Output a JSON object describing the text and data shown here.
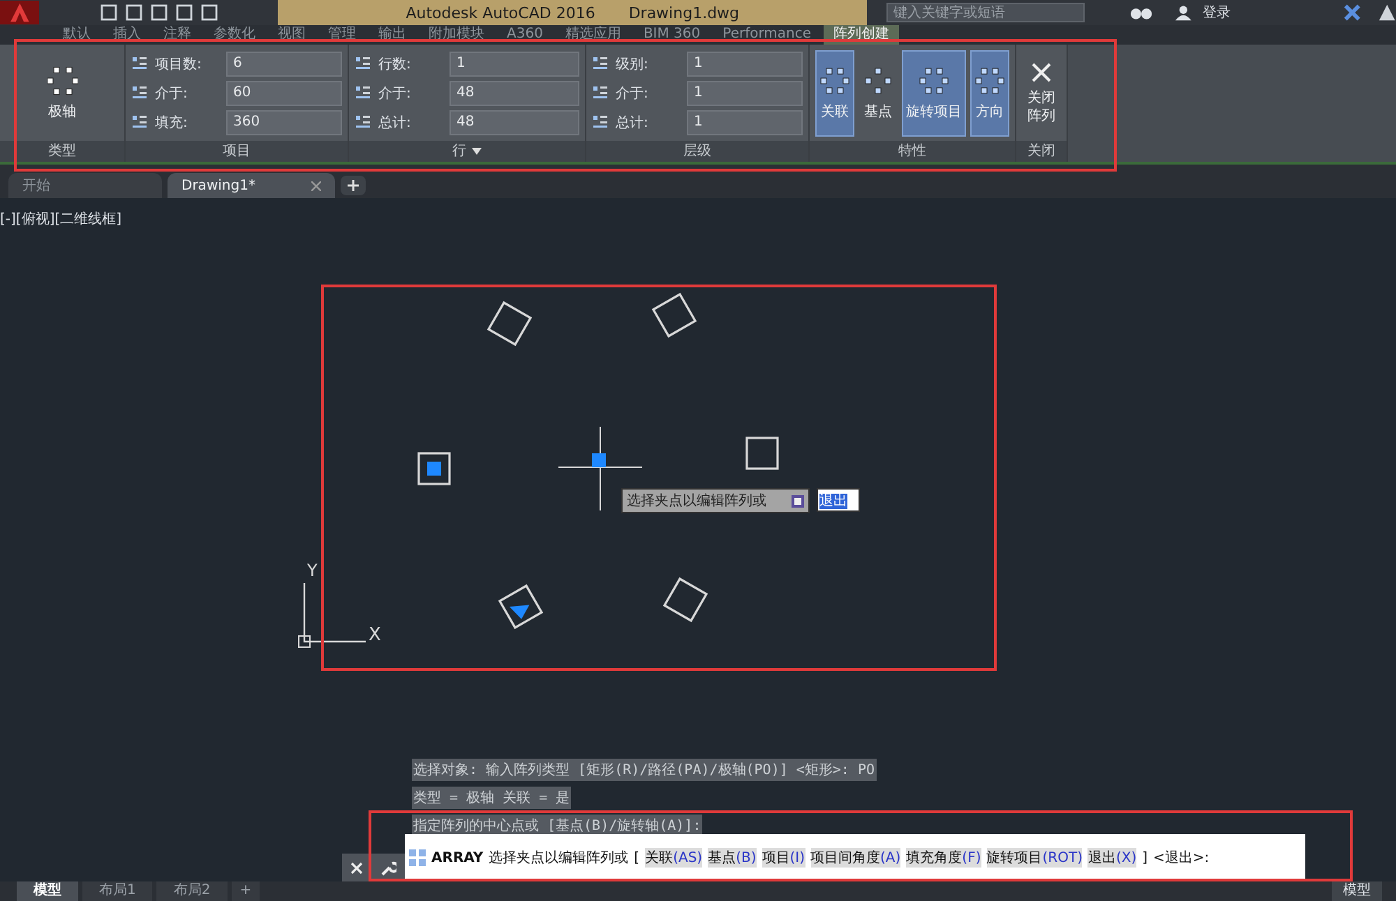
{
  "title_bar": {
    "app_title": "Autodesk AutoCAD 2016",
    "file_name": "Drawing1.dwg",
    "search": {
      "placeholder": "键入关键字或短语"
    },
    "sign_in": "登录"
  },
  "ribbon_tabs": [
    {
      "label": "默认",
      "selected": false
    },
    {
      "label": "插入",
      "selected": false
    },
    {
      "label": "注释",
      "selected": false
    },
    {
      "label": "参数化",
      "selected": false
    },
    {
      "label": "视图",
      "selected": false
    },
    {
      "label": "管理",
      "selected": false
    },
    {
      "label": "输出",
      "selected": false
    },
    {
      "label": "附加模块",
      "selected": false
    },
    {
      "label": "A360",
      "selected": false
    },
    {
      "label": "精选应用",
      "selected": false
    },
    {
      "label": "BIM 360",
      "selected": false
    },
    {
      "label": "Performance",
      "selected": false
    },
    {
      "label": "阵列创建",
      "selected": true
    }
  ],
  "ribbon_panels": [
    {
      "kind": "type",
      "title": "类型",
      "button": "极轴"
    },
    {
      "kind": "fields",
      "title": "项目",
      "fields": [
        {
          "label": "项目数:",
          "value": "6"
        },
        {
          "label": "介于:",
          "value": "60"
        },
        {
          "label": "填充:",
          "value": "360"
        }
      ]
    },
    {
      "kind": "fields",
      "title": "行",
      "dropdown": true,
      "fields": [
        {
          "label": "行数:",
          "value": "1"
        },
        {
          "label": "介于:",
          "value": "48"
        },
        {
          "label": "总计:",
          "value": "48"
        }
      ]
    },
    {
      "kind": "fields",
      "title": "层级",
      "fields": [
        {
          "label": "级别:",
          "value": "1"
        },
        {
          "label": "介于:",
          "value": "1"
        },
        {
          "label": "总计:",
          "value": "1"
        }
      ]
    },
    {
      "kind": "properties",
      "title": "特性",
      "buttons": [
        {
          "label": "关联",
          "selected": true
        },
        {
          "label": "基点",
          "selected": false
        },
        {
          "label": "旋转项目",
          "selected": true
        },
        {
          "label": "方向",
          "selected": true
        }
      ]
    },
    {
      "kind": "close",
      "title": "关闭",
      "button": "关闭阵列"
    }
  ],
  "doc_tabs": [
    {
      "label": "开始",
      "selected": false
    },
    {
      "label": "Drawing1*",
      "selected": true
    }
  ],
  "viewport_label": "[-][俯视][二维线框]",
  "ucs": {
    "x": "X",
    "y": "Y"
  },
  "grip_tooltip": {
    "text": "选择夹点以编辑阵列或",
    "option": "退出"
  },
  "command": {
    "history": [
      "选择对象:  输入阵列类型 [矩形(R)/路径(PA)/极轴(PO)] <矩形>: PO",
      "类型 = 极轴  关联 = 是",
      "指定阵列的中心点或 [基点(B)/旋转轴(A)]:"
    ],
    "name": "ARRAY",
    "prompt": "选择夹点以编辑阵列或",
    "bracket_open": "[",
    "bracket_close": "]",
    "options": [
      {
        "label": "关联",
        "key": "(AS)"
      },
      {
        "label": "基点",
        "key": "(B)"
      },
      {
        "label": "项目",
        "key": "(I)"
      },
      {
        "label": "项目间角度",
        "key": "(A)"
      },
      {
        "label": "填充角度",
        "key": "(F)"
      },
      {
        "label": "旋转项目",
        "key": "(ROT)"
      },
      {
        "label": "退出",
        "key": "(X)"
      }
    ],
    "default": "<退出>:"
  },
  "layout_tabs": [
    {
      "label": "模型",
      "selected": true
    },
    {
      "label": "布局1",
      "selected": false
    },
    {
      "label": "布局2",
      "selected": false
    }
  ],
  "add_tab": "+",
  "status_bar": {
    "model": "模型"
  }
}
